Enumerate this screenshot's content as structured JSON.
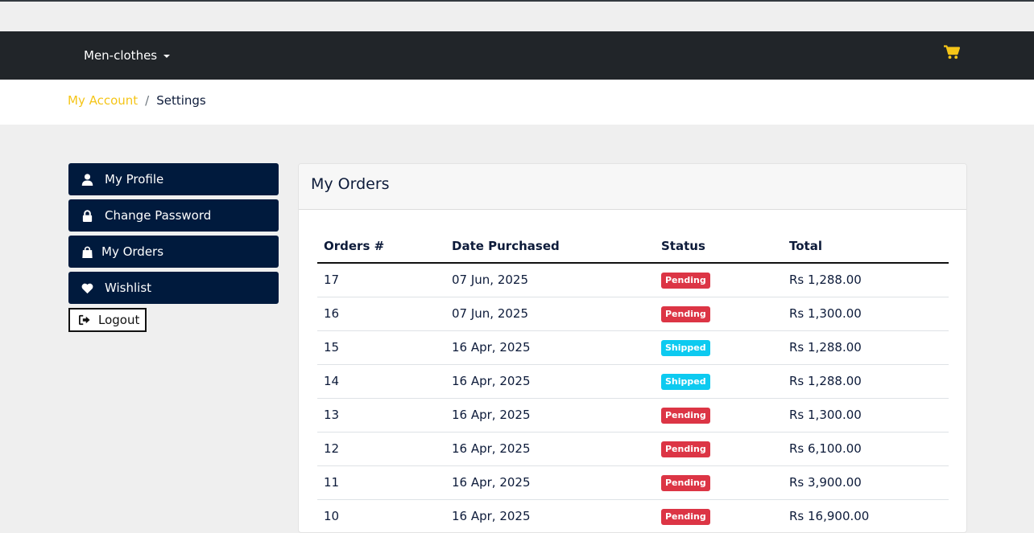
{
  "nav": {
    "dropdown_label": "Men-clothes",
    "cart_icon": "shopping-cart-icon",
    "cart_icon_color": "#f5c518",
    "background_color": "#212529"
  },
  "breadcrumb": {
    "link": "My Account",
    "separator": "/",
    "current": "Settings"
  },
  "sidebar": {
    "items": [
      {
        "label": "My Profile",
        "icon": "user-icon"
      },
      {
        "label": "Change Password",
        "icon": "lock-icon"
      },
      {
        "label": "My Orders",
        "icon": "shopping-bag-icon"
      },
      {
        "label": "Wishlist",
        "icon": "heart-icon"
      }
    ],
    "logout": {
      "label": "Logout",
      "icon": "sign-out-icon"
    },
    "button_color": "#001a3d"
  },
  "orders": {
    "title": "My Orders",
    "columns": [
      "Orders #",
      "Date Purchased",
      "Status",
      "Total"
    ],
    "status_colors": {
      "Pending": "#dc3545",
      "Shipped": "#0dcaf0"
    },
    "rows": [
      {
        "id": "17",
        "date": "07 Jun, 2025",
        "status": "Pending",
        "total": "Rs 1,288.00"
      },
      {
        "id": "16",
        "date": "07 Jun, 2025",
        "status": "Pending",
        "total": "Rs 1,300.00"
      },
      {
        "id": "15",
        "date": "16 Apr, 2025",
        "status": "Shipped",
        "total": "Rs 1,288.00"
      },
      {
        "id": "14",
        "date": "16 Apr, 2025",
        "status": "Shipped",
        "total": "Rs 1,288.00"
      },
      {
        "id": "13",
        "date": "16 Apr, 2025",
        "status": "Pending",
        "total": "Rs 1,300.00"
      },
      {
        "id": "12",
        "date": "16 Apr, 2025",
        "status": "Pending",
        "total": "Rs 6,100.00"
      },
      {
        "id": "11",
        "date": "16 Apr, 2025",
        "status": "Pending",
        "total": "Rs 3,900.00"
      },
      {
        "id": "10",
        "date": "16 Apr, 2025",
        "status": "Pending",
        "total": "Rs 16,900.00"
      }
    ]
  }
}
